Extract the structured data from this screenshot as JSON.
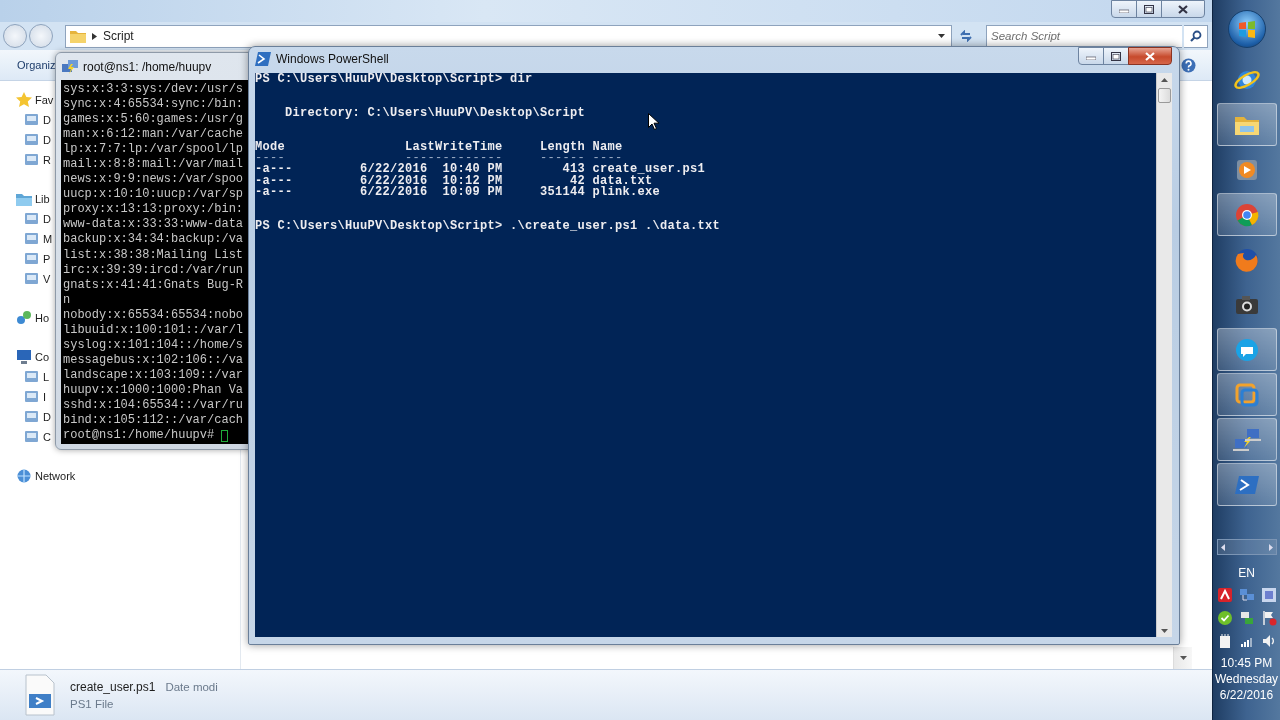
{
  "explorer": {
    "address": {
      "crumb": "Script"
    },
    "search": {
      "placeholder": "Search Script"
    },
    "toolbar": {
      "organize": "Organiz"
    },
    "nav": [
      {
        "label": "Fav",
        "children": [
          {
            "label": "D"
          },
          {
            "label": "D"
          },
          {
            "label": "R"
          }
        ]
      },
      {
        "label": "Lib",
        "children": [
          {
            "label": "D"
          },
          {
            "label": "M"
          },
          {
            "label": "P"
          },
          {
            "label": "V"
          }
        ]
      },
      {
        "label": "Ho"
      },
      {
        "label": "Co",
        "children": [
          {
            "label": "L"
          },
          {
            "label": "I"
          },
          {
            "label": "D"
          },
          {
            "label": "C"
          }
        ]
      },
      {
        "label": "Network"
      }
    ],
    "details": {
      "name": "create_user.ps1",
      "field": "Date modi",
      "type": "PS1 File"
    }
  },
  "putty": {
    "title": "root@ns1: /home/huupv",
    "lines": [
      "sys:x:3:3:sys:/dev:/usr/s",
      "sync:x:4:65534:sync:/bin:",
      "games:x:5:60:games:/usr/g",
      "man:x:6:12:man:/var/cache",
      "lp:x:7:7:lp:/var/spool/lp",
      "mail:x:8:8:mail:/var/mail",
      "news:x:9:9:news:/var/spoo",
      "uucp:x:10:10:uucp:/var/sp",
      "proxy:x:13:13:proxy:/bin:",
      "www-data:x:33:33:www-data",
      "backup:x:34:34:backup:/va",
      "list:x:38:38:Mailing List",
      "irc:x:39:39:ircd:/var/run",
      "gnats:x:41:41:Gnats Bug-R",
      "n",
      "nobody:x:65534:65534:nobo",
      "libuuid:x:100:101::/var/l",
      "syslog:x:101:104::/home/s",
      "messagebus:x:102:106::/va",
      "landscape:x:103:109::/var",
      "huupv:x:1000:1000:Phan Va",
      "sshd:x:104:65534::/var/ru",
      "bind:x:105:112::/var/cach"
    ],
    "prompt": "root@ns1:/home/huupv#",
    "cursor": true
  },
  "powershell": {
    "title": "Windows PowerShell",
    "lines": [
      {
        "kind": "command",
        "text": "PS C:\\Users\\HuuPV\\Desktop\\Script> dir"
      },
      {
        "kind": "heading",
        "text": "    Directory: C:\\Users\\HuuPV\\Desktop\\Script"
      },
      {
        "kind": "table_header",
        "text": "Mode                LastWriteTime     Length Name"
      },
      {
        "kind": "rule",
        "text": "----                -------------     ------ ----"
      },
      {
        "kind": "row",
        "text": "-a---         6/22/2016  10:40 PM        413 create_user.ps1"
      },
      {
        "kind": "row",
        "text": "-a---         6/22/2016  10:12 PM         42 data.txt"
      },
      {
        "kind": "row",
        "text": "-a---         6/22/2016  10:09 PM     351144 plink.exe"
      },
      {
        "kind": "command",
        "text": "PS C:\\Users\\HuuPV\\Desktop\\Script> .\\create_user.ps1 .\\data.txt"
      }
    ]
  },
  "taskbar": {
    "apps": [
      {
        "running": false
      },
      {
        "running": true
      },
      {
        "running": false
      },
      {
        "running": true
      },
      {
        "running": false
      },
      {
        "running": false
      },
      {
        "running": true
      },
      {
        "running": true
      },
      {
        "running": true
      },
      {
        "running": true
      }
    ],
    "language": "EN",
    "clock": {
      "time": "10:45 PM",
      "day": "Wednesday",
      "date": "6/22/2016"
    }
  }
}
